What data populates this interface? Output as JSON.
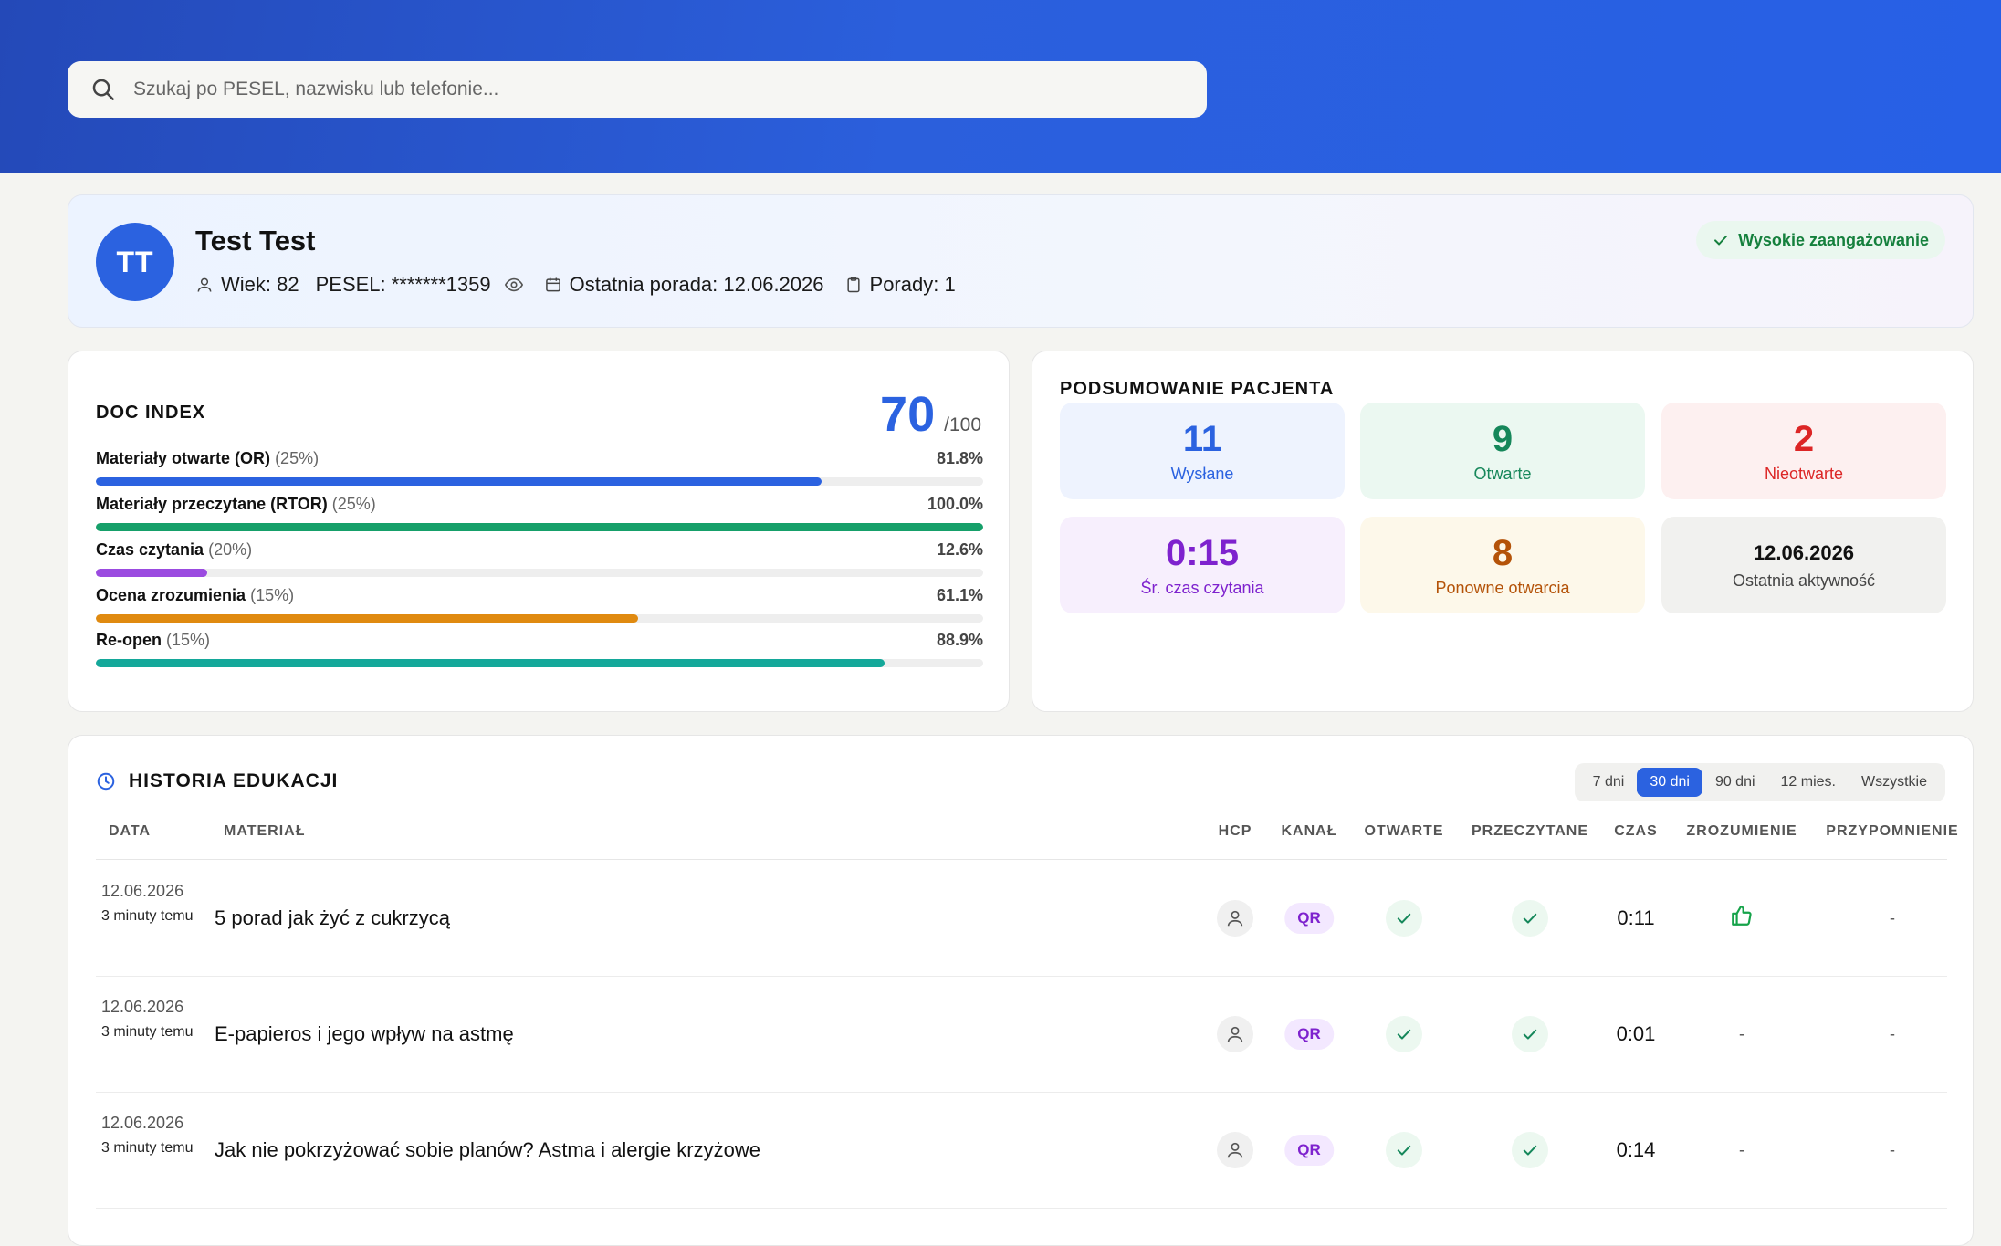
{
  "search": {
    "placeholder": "Szukaj po PESEL, nazwisku lub telefonie..."
  },
  "patient": {
    "initials": "TT",
    "name": "Test Test",
    "age_text": "Wiek: 82",
    "pesel_text": "PESEL: *******1359",
    "last_advice_text": "Ostatnia porada: 12.06.2026",
    "advice_count_text": "Porady: 1",
    "engagement_label": "Wysokie zaangażowanie"
  },
  "doc_index": {
    "title": "DOC INDEX",
    "score": "70",
    "score_max": "/100",
    "metrics": [
      {
        "label": "Materiały otwarte (OR)",
        "weight": "(25%)",
        "value_text": "81.8%",
        "value": 81.8,
        "color": "#2b62e0"
      },
      {
        "label": "Materiały przeczytane (RTOR)",
        "weight": "(25%)",
        "value_text": "100.0%",
        "value": 100.0,
        "color": "#16a06a"
      },
      {
        "label": "Czas czytania",
        "weight": "(20%)",
        "value_text": "12.6%",
        "value": 12.6,
        "color": "#9b4be0"
      },
      {
        "label": "Ocena zrozumienia",
        "weight": "(15%)",
        "value_text": "61.1%",
        "value": 61.1,
        "color": "#e08a10"
      },
      {
        "label": "Re-open",
        "weight": "(15%)",
        "value_text": "88.9%",
        "value": 88.9,
        "color": "#14a89a"
      }
    ]
  },
  "summary": {
    "title": "PODSUMOWANIE PACJENTA",
    "tiles": [
      {
        "value": "11",
        "label": "Wysłane",
        "bg": "#eef3fe",
        "color": "#2b62e0"
      },
      {
        "value": "9",
        "label": "Otwarte",
        "bg": "#ebf8f1",
        "color": "#15875a"
      },
      {
        "value": "2",
        "label": "Nieotwarte",
        "bg": "#fdf0f0",
        "color": "#dc2626"
      },
      {
        "value": "0:15",
        "label": "Śr. czas czytania",
        "bg": "#f7effd",
        "color": "#7e22ce"
      },
      {
        "value": "8",
        "label": "Ponowne otwarcia",
        "bg": "#fdf8ea",
        "color": "#b45309"
      },
      {
        "value": "12.06.2026",
        "label": "Ostatnia aktywność",
        "bg": "#f1f1ef",
        "color": "#333333"
      }
    ]
  },
  "history": {
    "title": "HISTORIA EDUKACJI",
    "filters": [
      "7 dni",
      "30 dni",
      "90 dni",
      "12 mies.",
      "Wszystkie"
    ],
    "active_filter": "30 dni",
    "columns": [
      "DATA",
      "MATERIAŁ",
      "HCP",
      "KANAŁ",
      "OTWARTE",
      "PRZECZYTANE",
      "CZAS",
      "ZROZUMIENIE",
      "PRZYPOMNIENIE"
    ],
    "rows": [
      {
        "date": "12.06.2026",
        "relative": "3 minuty temu",
        "material": "5 porad jak żyć z cukrzycą",
        "channel": "QR",
        "time": "0:11",
        "understanding": "thumb-up-icon",
        "reminder": "-"
      },
      {
        "date": "12.06.2026",
        "relative": "3 minuty temu",
        "material": "E-papieros i jego wpływ na astmę",
        "channel": "QR",
        "time": "0:01",
        "understanding": "-",
        "reminder": "-"
      },
      {
        "date": "12.06.2026",
        "relative": "3 minuty temu",
        "material": "Jak nie pokrzyżować sobie planów? Astma i alergie krzyżowe",
        "channel": "QR",
        "time": "0:14",
        "understanding": "-",
        "reminder": "-"
      }
    ]
  }
}
